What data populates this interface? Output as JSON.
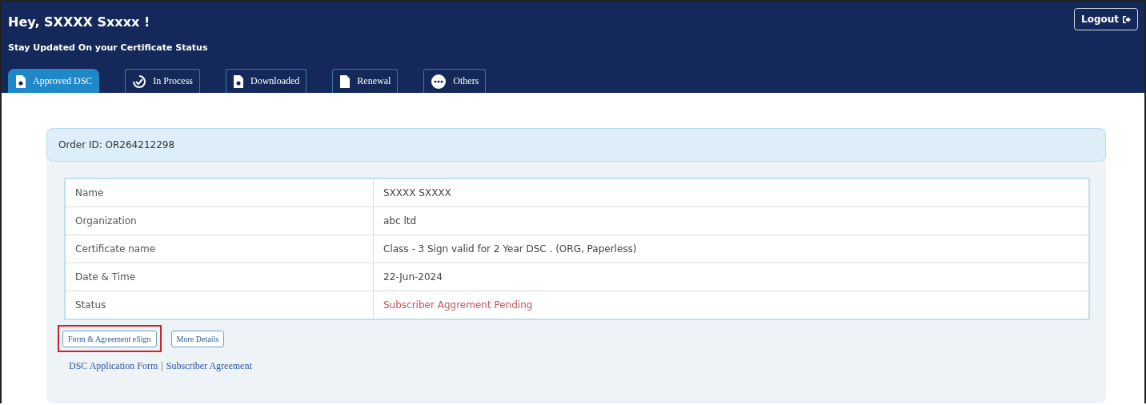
{
  "header": {
    "greeting": "Hey, SXXXX Sxxxx !",
    "subtitle": "Stay Updated On your Certificate Status",
    "logout": "Logout"
  },
  "tabs": [
    {
      "label": "Approved DSC",
      "kind": "document",
      "selected": true
    },
    {
      "label": "In Process",
      "kind": "progress",
      "selected": false
    },
    {
      "label": "Downloaded",
      "kind": "document",
      "selected": false
    },
    {
      "label": "Renewal",
      "kind": "page",
      "selected": false
    },
    {
      "label": "Others",
      "kind": "more",
      "selected": false
    }
  ],
  "order": {
    "title": "Order ID: OR264212298",
    "rows": [
      {
        "label": "Name",
        "value": "SXXXX SXXXX",
        "kind": "text"
      },
      {
        "label": "Organization",
        "value": "abc ltd",
        "kind": "text"
      },
      {
        "label": "Certificate name",
        "value": "Class - 3 Sign valid for 2 Year DSC . (ORG, Paperless)",
        "kind": "text"
      },
      {
        "label": "Date & Time",
        "value": "22-Jun-2024",
        "kind": "text"
      },
      {
        "label": "Status",
        "value": "Subscriber Aggrement Pending",
        "kind": "alert"
      }
    ],
    "buttons": [
      {
        "label": "Form & Agreement eSign",
        "highlighted": true
      },
      {
        "label": "More Details",
        "highlighted": false
      }
    ],
    "links": [
      "DSC Application Form",
      "Subscriber Agreement"
    ],
    "link_separator": "|"
  }
}
